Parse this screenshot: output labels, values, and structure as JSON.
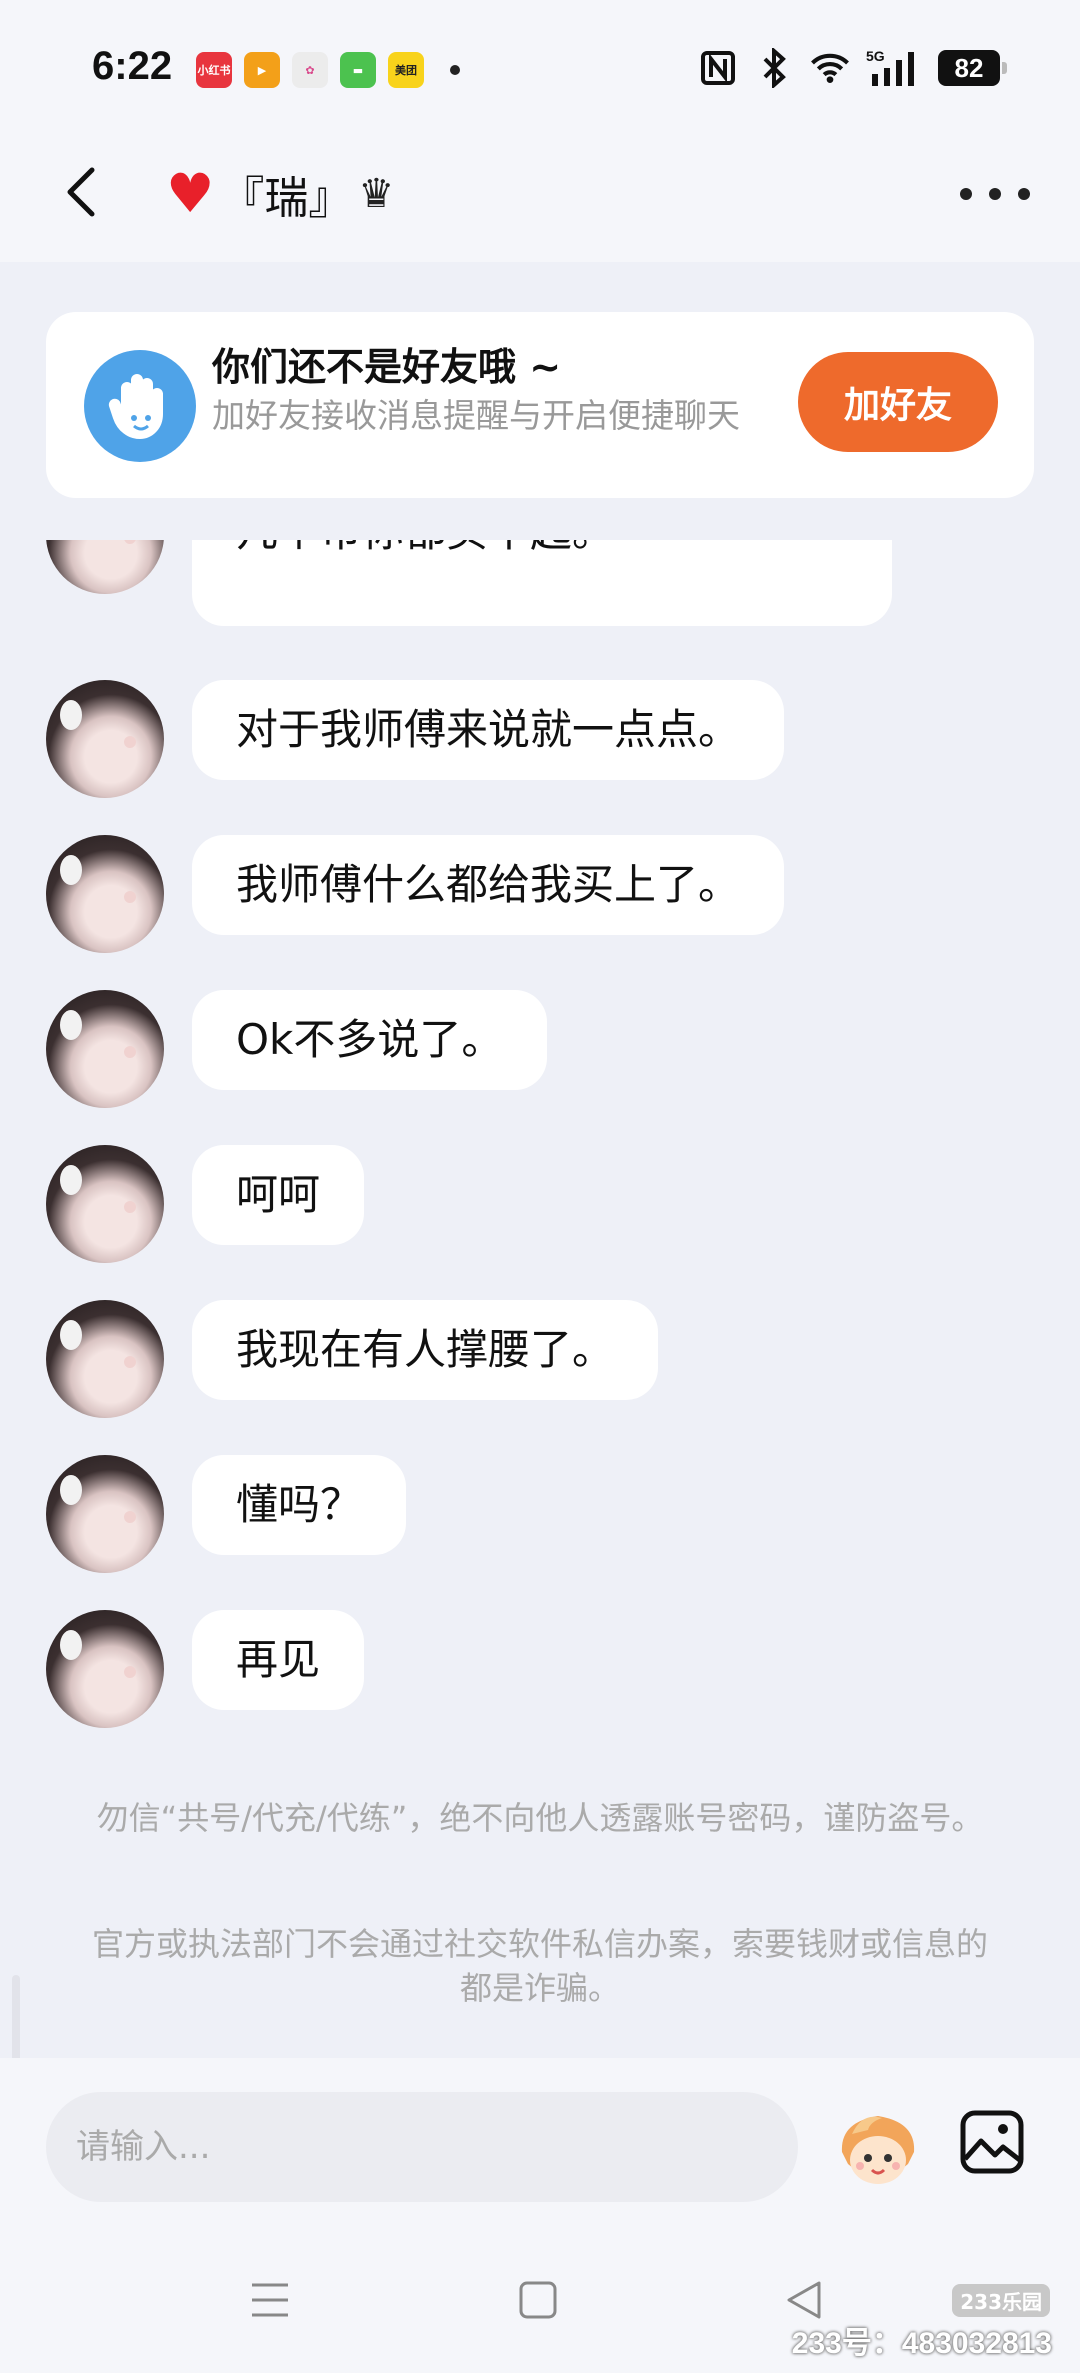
{
  "status_bar": {
    "time": "6:22",
    "apps": [
      {
        "label": "小红书",
        "color": "#e8353e"
      },
      {
        "label": "▶",
        "color": "#f3a019"
      },
      {
        "label": "✿",
        "color": "#ececec"
      },
      {
        "label": "▬",
        "color": "#4cc24f"
      },
      {
        "label": "美团",
        "color": "#f8d31b"
      }
    ],
    "network": "5G",
    "battery": "82"
  },
  "header": {
    "title": "『瑞』"
  },
  "banner": {
    "title": "你们还不是好友哦 ~",
    "subtitle": "加好友接收消息提醒与开启便捷聊天",
    "button": "加好友"
  },
  "messages": [
    {
      "text": "几个币你都买不起。",
      "partial_top": "..."
    },
    {
      "text": "对于我师傅来说就一点点。"
    },
    {
      "text": "我师傅什么都给我买上了。"
    },
    {
      "text": "Ok不多说了。"
    },
    {
      "text": "呵呵"
    },
    {
      "text": "我现在有人撑腰了。"
    },
    {
      "text": "懂吗？"
    },
    {
      "text": "再见"
    }
  ],
  "warnings": [
    "勿信“共号/代充/代练”，绝不向他人透露账号密码，谨防盗号。",
    "官方或执法部门不会通过社交软件私信办案，索要钱财或信息的都是诈骗。"
  ],
  "input": {
    "placeholder": "请输入..."
  },
  "watermark": {
    "logo": "233乐园",
    "id": "233号：483032813"
  },
  "colors": {
    "accent": "#ee6a2c",
    "wave_icon": "#4fa3e8",
    "background": "#eef0f7"
  }
}
